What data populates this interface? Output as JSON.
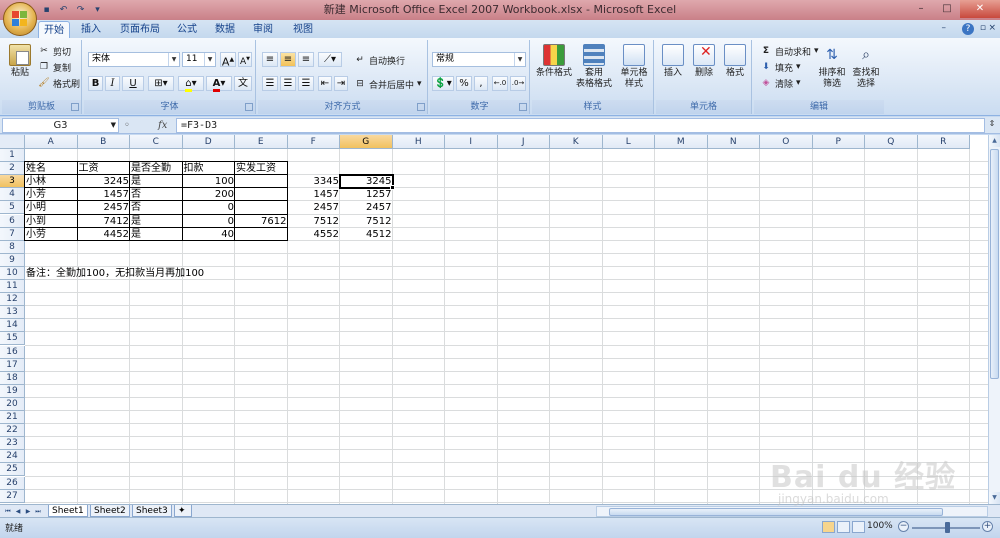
{
  "window": {
    "title": "新建 Microsoft Office Excel 2007 Workbook.xlsx - Microsoft Excel",
    "controls": [
      "–",
      "□",
      "✕"
    ]
  },
  "tabs": [
    {
      "label": "开始",
      "active": true
    },
    {
      "label": "插入"
    },
    {
      "label": "页面布局"
    },
    {
      "label": "公式"
    },
    {
      "label": "数据"
    },
    {
      "label": "审阅"
    },
    {
      "label": "视图"
    }
  ],
  "ribbon": {
    "clipboard": {
      "paste": "粘贴",
      "cut": "剪切",
      "copy": "复制",
      "format_painter": "格式刷",
      "label": "剪贴板"
    },
    "font": {
      "name": "宋体",
      "size": "11",
      "bold": "B",
      "italic": "I",
      "underline": "U",
      "grow": "A",
      "shrink": "A",
      "label": "字体"
    },
    "alignment": {
      "wrap": "自动换行",
      "merge": "合并后居中",
      "label": "对齐方式"
    },
    "number": {
      "format": "常规",
      "percent": "%",
      "comma": ",",
      "label": "数字"
    },
    "styles": {
      "conditional": "条件格式",
      "table": "套用\n表格格式",
      "cell": "单元格\n样式",
      "label": "样式"
    },
    "cells": {
      "insert": "插入",
      "delete": "删除",
      "format": "格式",
      "label": "单元格"
    },
    "editing": {
      "autosum": "自动求和",
      "fill": "填充",
      "clear": "清除",
      "sort": "排序和\n筛选",
      "find": "查找和\n选择",
      "label": "编辑"
    }
  },
  "formula_bar": {
    "name_box": "G3",
    "fx": "fx",
    "formula": "=F3-D3"
  },
  "columns": [
    "A",
    "B",
    "C",
    "D",
    "E",
    "F",
    "G",
    "H",
    "I",
    "J",
    "K",
    "L",
    "M",
    "N",
    "O",
    "P",
    "Q",
    "R"
  ],
  "rows": [
    "1",
    "2",
    "3",
    "4",
    "5",
    "6",
    "7",
    "8",
    "9",
    "10",
    "11",
    "12",
    "13",
    "14",
    "15",
    "16",
    "17",
    "18",
    "19",
    "20",
    "21",
    "22",
    "23",
    "24",
    "25",
    "26",
    "27"
  ],
  "selected_cell": {
    "col": "G",
    "row": "3"
  },
  "table": {
    "headers": [
      "姓名",
      "工资",
      "是否全勤",
      "扣款",
      "实发工资"
    ],
    "rows": [
      {
        "name": "小林",
        "salary": "3245",
        "full": "是",
        "deduct": "100",
        "net": "",
        "f": "3345",
        "g": "3245"
      },
      {
        "name": "小芳",
        "salary": "1457",
        "full": "否",
        "deduct": "200",
        "net": "",
        "f": "1457",
        "g": "1257"
      },
      {
        "name": "小明",
        "salary": "2457",
        "full": "否",
        "deduct": "0",
        "net": "",
        "f": "2457",
        "g": "2457"
      },
      {
        "name": "小到",
        "salary": "7412",
        "full": "是",
        "deduct": "0",
        "net": "7612",
        "f": "7512",
        "g": "7512"
      },
      {
        "name": "小劳",
        "salary": "4452",
        "full": "是",
        "deduct": "40",
        "net": "",
        "f": "4552",
        "g": "4512"
      }
    ]
  },
  "note": "备注：全勤加100，无扣款当月再加100",
  "sheets": [
    {
      "label": "Sheet1",
      "active": true
    },
    {
      "label": "Sheet2"
    },
    {
      "label": "Sheet3"
    }
  ],
  "status": {
    "ready": "就绪",
    "zoom": "100%"
  },
  "watermark": {
    "text": "Bai du 经验",
    "sub": "jingyan.baidu.com"
  }
}
